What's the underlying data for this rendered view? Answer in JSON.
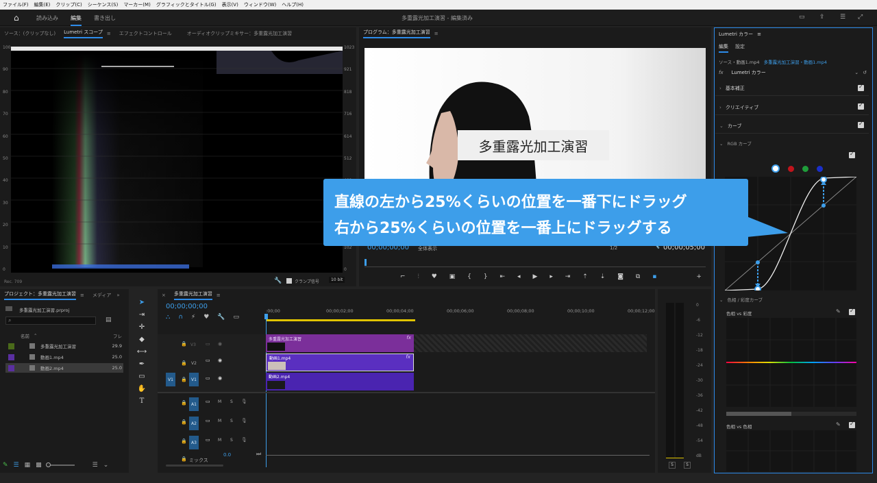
{
  "menu": [
    "ファイル(F)",
    "編集(E)",
    "クリップ(C)",
    "シーケンス(S)",
    "マーカー(M)",
    "グラフィックとタイトル(G)",
    "表示(V)",
    "ウィンドウ(W)",
    "ヘルプ(H)"
  ],
  "workspace": {
    "tabs": [
      "読み込み",
      "編集",
      "書き出し"
    ],
    "title": "多重露光加工演習 - 編集済み"
  },
  "source_panel": {
    "tabs": [
      "ソース：(クリップなし)",
      "Lumetri スコープ",
      "エフェクトコントロール",
      "オーディオクリップミキサー：多重露光加工演習"
    ],
    "scale_left": [
      "100",
      "90",
      "80",
      "70",
      "60",
      "50",
      "40",
      "30",
      "20",
      "10",
      "0"
    ],
    "scale_right": [
      "1023",
      "921",
      "818",
      "716",
      "614",
      "512",
      "409",
      "307",
      "205",
      "102",
      "0"
    ],
    "footer_left": "Rec. 709",
    "clamp_label": "クランプ信号",
    "bit_depth": "10 bit"
  },
  "program_panel": {
    "title": "プログラム：多重露光加工演習",
    "overlay_text": "多重露光加工演習",
    "timecode_left": "00;00;00;00",
    "fit": "全体表示",
    "quality": "1/2",
    "timecode_right": "00;00;05;00"
  },
  "callout": {
    "line1": "直線の左から25%くらいの位置を一番下にドラッグ",
    "line2": "右から25%くらいの位置を一番上にドラッグする"
  },
  "lumetri": {
    "title": "Lumetri カラー",
    "tabs": [
      "編集",
      "設定"
    ],
    "source_line": "ソース・動画1.mp4",
    "seq_line": "多重露光加工演習・動画1.mp4",
    "fx_label": "fx",
    "effect": "Lumetri カラー",
    "sections": [
      "基本補正",
      "クリエイティブ",
      "カーブ"
    ],
    "rgb_curve": "RGB カーブ",
    "hue_sat": "色相 / 彩度カーブ",
    "hue_vs_sat": "色相 vs 彩度",
    "hue_vs_hue": "色相 vs 色相",
    "curve_colors": [
      "#ffffff",
      "#c0141c",
      "#1f9d3a",
      "#1a2fc8"
    ]
  },
  "project_panel": {
    "title": "プロジェクト：多重露光加工演習",
    "tab2": "メディア",
    "file": "多重露光加工演習.prproj",
    "col_name": "名前",
    "col_rate": "フレ",
    "items": [
      {
        "name": "多重露光加工演習",
        "rate": "29.9",
        "color": "#4a6a1a"
      },
      {
        "name": "動画1.mp4",
        "rate": "25.0",
        "color": "#5a2fa0"
      },
      {
        "name": "動画2.mp4",
        "rate": "25.0",
        "color": "#5a2fa0"
      }
    ]
  },
  "timeline": {
    "title": "多重露光加工演習",
    "timecode": "00;00;00;00",
    "ruler": [
      ":00;00",
      "00;00;02;00",
      "00;00;04;00",
      "00;00;06;00",
      "00;00;08;00",
      "00;00;10;00",
      "00;00;12;00"
    ],
    "tracks_video": [
      "V3",
      "V2",
      "V1"
    ],
    "tracks_audio": [
      "A1",
      "A2",
      "A3"
    ],
    "src_patch": "V1",
    "mix_label": "ミックス",
    "mix_value": "0.0",
    "m_label": "M",
    "s_label": "S",
    "clip_v3": "多重露光加工演習",
    "clip_v2": "動画1.mp4",
    "clip_v1": "動画2.mp4",
    "fx": "fx"
  },
  "meter": {
    "labels": [
      "0",
      "-6",
      "-12",
      "-18",
      "-24",
      "-30",
      "-36",
      "-42",
      "-48",
      "-54",
      "dB"
    ],
    "solo": "S"
  }
}
